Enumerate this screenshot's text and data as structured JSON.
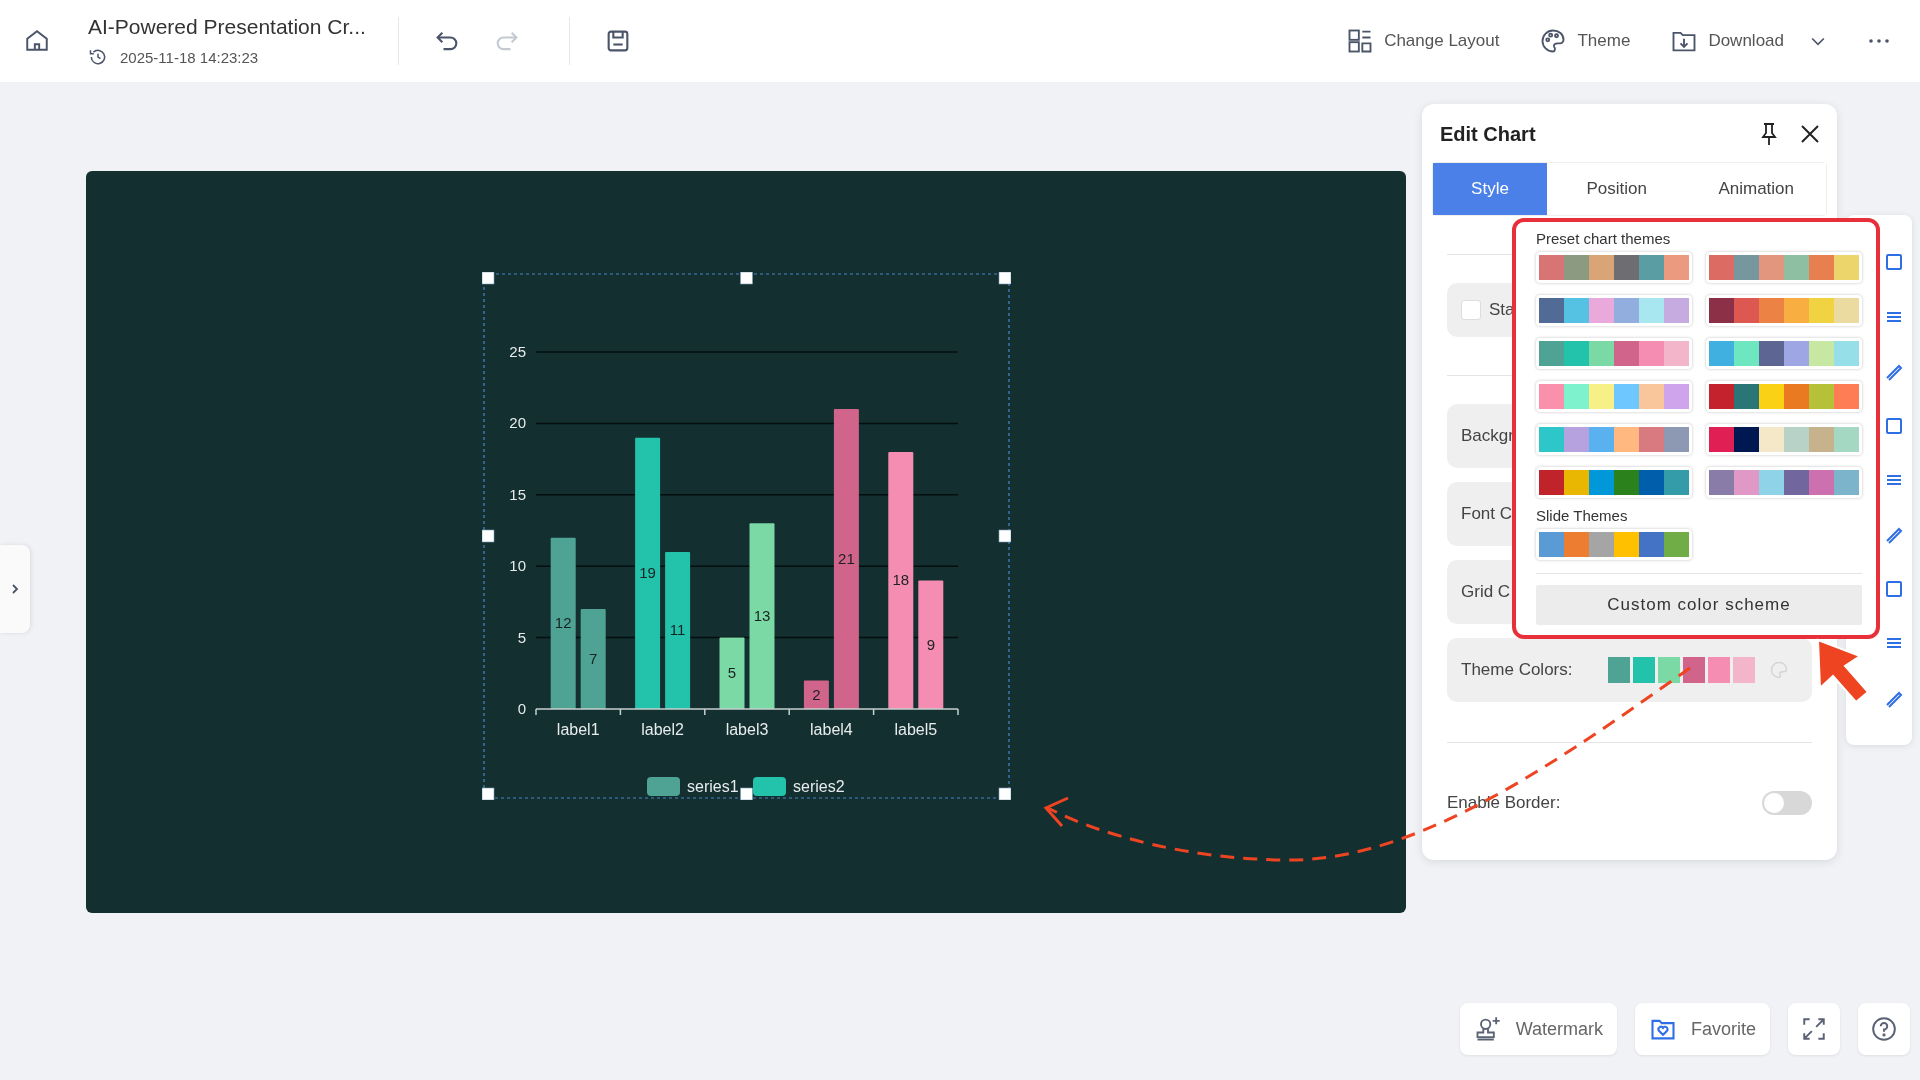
{
  "header": {
    "title": "AI-Powered Presentation Cr...",
    "timestamp": "2025-11-18 14:23:23",
    "actions": [
      {
        "label": "Change Layout",
        "kind": "layout"
      },
      {
        "label": "Theme",
        "kind": "theme"
      },
      {
        "label": "Download",
        "kind": "download"
      }
    ]
  },
  "slide": {
    "chart_data": {
      "type": "bar",
      "categories": [
        "label1",
        "label2",
        "label3",
        "label4",
        "label5"
      ],
      "series": [
        {
          "name": "series1",
          "color": "#4fa394",
          "colors": [
            "#4fa394",
            "#22c3aa",
            "#7bd9a5",
            "#d0648a",
            "#f58db2"
          ],
          "values": [
            12,
            19,
            5,
            2,
            18
          ]
        },
        {
          "name": "series2",
          "color": "#22c3aa",
          "colors": [
            "#4fa394",
            "#22c3aa",
            "#7bd9a5",
            "#d0648a",
            "#f58db2"
          ],
          "values": [
            7,
            11,
            13,
            21,
            9
          ]
        }
      ],
      "ylim": [
        0,
        25
      ],
      "yticks": [
        0,
        5,
        10,
        15,
        20,
        25
      ],
      "data_labels": true,
      "grid": true,
      "legend": true
    }
  },
  "panel": {
    "title": "Edit Chart",
    "tabs": [
      {
        "label": "Style",
        "selected": true
      },
      {
        "label": "Position",
        "selected": false
      },
      {
        "label": "Animation",
        "selected": false
      }
    ],
    "stacked": {
      "label": "Sta",
      "checked": false
    },
    "rows": [
      "Backgr",
      "Font C",
      "Grid C"
    ],
    "theme_colors": {
      "label": "Theme Colors:",
      "colors": [
        {
          "color": "#4fa394"
        },
        {
          "color": "#22c3aa"
        },
        {
          "color": "#7bd9a5"
        },
        {
          "color": "#d0648a"
        },
        {
          "color": "#f58db2"
        },
        {
          "color": "#f3b5ca"
        }
      ]
    },
    "border": {
      "label": "Enable Border:",
      "on": false
    }
  },
  "popup": {
    "preset_title": "Preset chart themes",
    "presets": [
      [
        {
          "color": "#d87474"
        },
        {
          "color": "#8c9a82"
        },
        {
          "color": "#d9a577"
        },
        {
          "color": "#6e6e72"
        },
        {
          "color": "#5a9ea4"
        },
        {
          "color": "#eb9a80"
        }
      ],
      [
        {
          "color": "#dc6b63"
        },
        {
          "color": "#77979f"
        },
        {
          "color": "#e3967e"
        },
        {
          "color": "#8ebfa3"
        },
        {
          "color": "#e87f4f"
        },
        {
          "color": "#ecd66c"
        }
      ],
      [
        {
          "color": "#526a96"
        },
        {
          "color": "#55c1e3"
        },
        {
          "color": "#eaa9db"
        },
        {
          "color": "#91aede"
        },
        {
          "color": "#a8e6f0"
        },
        {
          "color": "#c6abe0"
        }
      ],
      [
        {
          "color": "#8c3048"
        },
        {
          "color": "#dc5850"
        },
        {
          "color": "#ec8244"
        },
        {
          "color": "#f9ae42"
        },
        {
          "color": "#f1d342"
        },
        {
          "color": "#ecdba0"
        }
      ],
      [
        {
          "color": "#4fa394"
        },
        {
          "color": "#22c3aa"
        },
        {
          "color": "#7bd9a5"
        },
        {
          "color": "#d0648a"
        },
        {
          "color": "#f58db2"
        },
        {
          "color": "#f3b5ca"
        }
      ],
      [
        {
          "color": "#3fb0e0"
        },
        {
          "color": "#6ee6bf"
        },
        {
          "color": "#5d6592"
        },
        {
          "color": "#9ea6e3"
        },
        {
          "color": "#c6e8a2"
        },
        {
          "color": "#96dfe8"
        }
      ],
      [
        {
          "color": "#fb90ac"
        },
        {
          "color": "#7ef2cc"
        },
        {
          "color": "#f6f086"
        },
        {
          "color": "#6ec8ff"
        },
        {
          "color": "#f8c69a"
        },
        {
          "color": "#d0a4ec"
        }
      ],
      [
        {
          "color": "#c4232e"
        },
        {
          "color": "#2a7677"
        },
        {
          "color": "#fbd116"
        },
        {
          "color": "#ea7a22"
        },
        {
          "color": "#b6c138"
        },
        {
          "color": "#fe7d55"
        }
      ],
      [
        {
          "color": "#2ec7c9"
        },
        {
          "color": "#b6a2de"
        },
        {
          "color": "#5ab1ef"
        },
        {
          "color": "#ffb980"
        },
        {
          "color": "#d87a80"
        },
        {
          "color": "#8d98b3"
        }
      ],
      [
        {
          "color": "#e01f54"
        },
        {
          "color": "#001852"
        },
        {
          "color": "#f5e8c8"
        },
        {
          "color": "#b8d2c7"
        },
        {
          "color": "#c6b38e"
        },
        {
          "color": "#a4d8c2"
        }
      ],
      [
        {
          "color": "#c1232b"
        },
        {
          "color": "#e9b702"
        },
        {
          "color": "#0098d9"
        },
        {
          "color": "#2b821d"
        },
        {
          "color": "#005eaa"
        },
        {
          "color": "#339ca8"
        }
      ],
      [
        {
          "color": "#8a7ca8"
        },
        {
          "color": "#e098c7"
        },
        {
          "color": "#8fd3e8"
        },
        {
          "color": "#71669e"
        },
        {
          "color": "#cc70af"
        },
        {
          "color": "#7cb4cc"
        }
      ]
    ],
    "slide_title": "Slide Themes",
    "slide_themes": [
      [
        {
          "color": "#5b9bd5"
        },
        {
          "color": "#ed7d31"
        },
        {
          "color": "#a5a5a5"
        },
        {
          "color": "#ffc000"
        },
        {
          "color": "#4472c4"
        },
        {
          "color": "#70ad47"
        }
      ]
    ],
    "custom_button": "Custom color scheme"
  },
  "bottom_buttons": [
    {
      "label": "Watermark",
      "kind": "watermark"
    },
    {
      "label": "Favorite",
      "kind": "favorite"
    },
    {
      "kind": "fullscreen"
    },
    {
      "kind": "help"
    }
  ]
}
